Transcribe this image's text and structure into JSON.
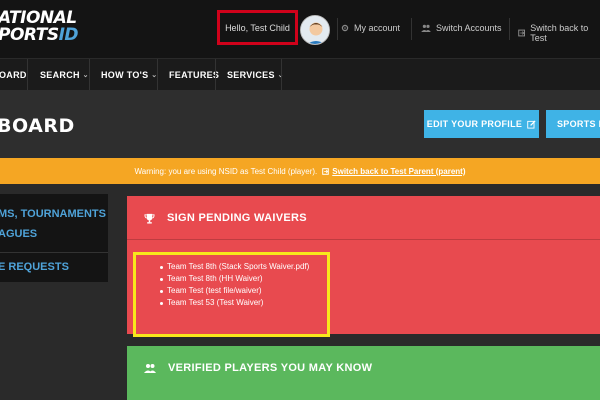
{
  "header": {
    "logo_line1": "ATIONAL",
    "logo_line2": "PORTS",
    "logo_id": "ID",
    "greeting": "Hello, Test Child",
    "my_account": "My account",
    "switch_accounts": "Switch Accounts",
    "switch_back": "Switch back to Test"
  },
  "nav": {
    "items": [
      "OARD",
      "SEARCH",
      "HOW TO'S",
      "FEATURES",
      "SERVICES"
    ]
  },
  "page": {
    "title": "BOARD",
    "edit_profile": "EDIT YOUR PROFILE",
    "sports_id": "SPORTS ID"
  },
  "warning": {
    "text": "Warning: you are using NSID as Test Child (player).",
    "link": "Switch back to Test Parent (parent)"
  },
  "sidebar": {
    "item1_line1": "MS, TOURNAMENTS",
    "item1_line2": "AGUES",
    "item2": "E REQUESTS"
  },
  "waivers": {
    "heading": "SIGN PENDING WAIVERS",
    "items": [
      "Team Test 8th (Stack Sports Waiver.pdf)",
      "Team Test 8th (HH Waiver)",
      "Team Test (test file/waiver)",
      "Team Test 53 (Test Waiver)"
    ]
  },
  "verified": {
    "heading": "VERIFIED PLAYERS YOU MAY KNOW"
  },
  "colors": {
    "accent_blue": "#3fb3e6",
    "warning_orange": "#f5a623",
    "panel_red": "#e84a4f",
    "panel_green": "#5bb85d",
    "highlight_red": "#d0021b",
    "highlight_yellow": "#f8e71c"
  },
  "icons": [
    "gear-icon",
    "users-icon",
    "switch-icon",
    "trophy-icon",
    "edit-icon",
    "friends-icon"
  ]
}
